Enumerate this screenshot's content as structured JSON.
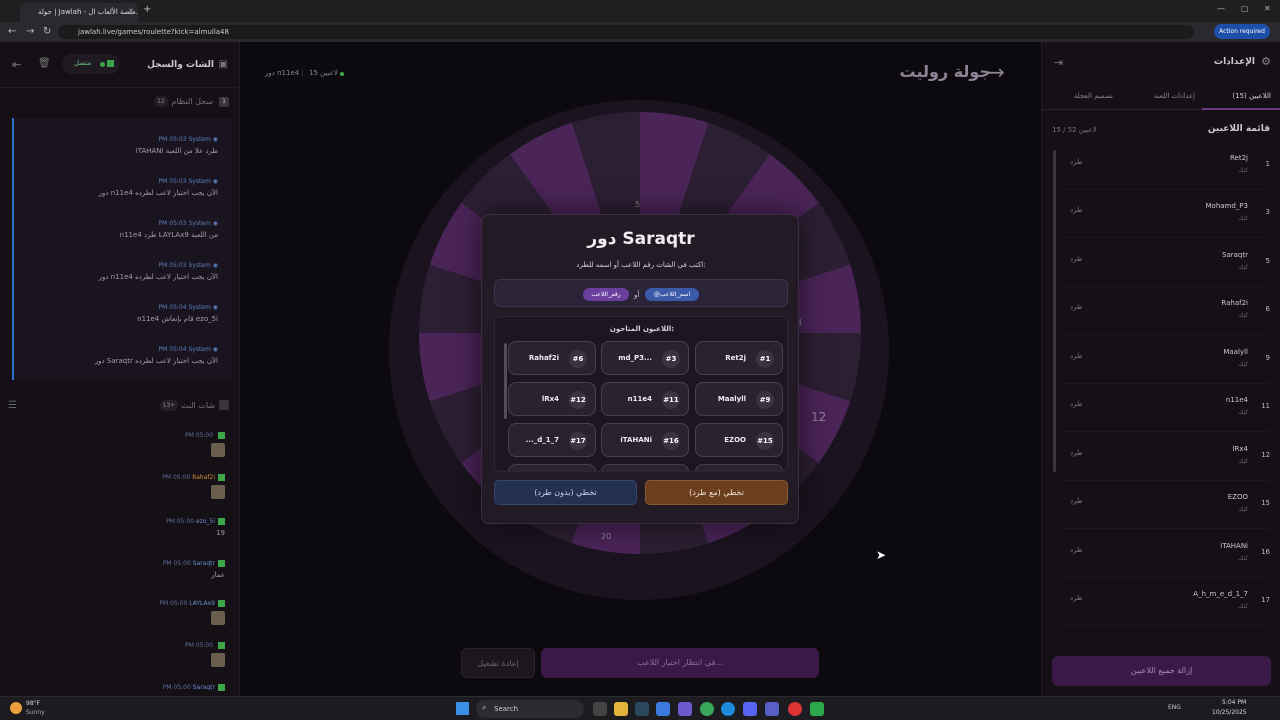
{
  "browser": {
    "tab_title": "جولة | Jawlah - منصة الألعاب ال...",
    "new_tab": "+",
    "url": "jawlah.live/games/roulette?kick=almulla48",
    "action_required": "Action required",
    "window_controls": [
      "—",
      "▢",
      "✕"
    ]
  },
  "left_panel": {
    "title": "الشات والسجل",
    "status": "متصل",
    "system_log": {
      "title": "سجل النظام",
      "count": "12",
      "badge": "1",
      "entries": [
        {
          "author": "System",
          "time": "PM 05:03",
          "text": "iTAHANi طرد علا من اللعبة"
        },
        {
          "author": "System",
          "time": "PM 05:03",
          "text": "دور n11e4 الآن يجب اختيار لاعب لطرده"
        },
        {
          "author": "System",
          "time": "PM 05:03",
          "text": "n11e4 طرد LAYLAx9 من اللعبة"
        },
        {
          "author": "System",
          "time": "PM 05:03",
          "text": "دور n11e4 الآن يجب اختيار لاعب لطرده"
        },
        {
          "author": "System",
          "time": "PM 05:04",
          "text": "n11e4 قام بإنعاش ezo_5i"
        },
        {
          "author": "System",
          "time": "PM 05:04",
          "text": "دور Saraqtr الآن يجب اختيار لاعب لطرده"
        }
      ]
    },
    "live_chat": {
      "title": "شات البث",
      "count": "13+",
      "entries": [
        {
          "author": "",
          "time": "PM 05:00",
          "text": "",
          "sticker": true
        },
        {
          "author": "Rahaf2i",
          "time": "PM 05:00",
          "text": "",
          "sticker": true
        },
        {
          "author": "ezo_5i",
          "time": "PM 05:00",
          "text": "19",
          "sticker": false
        },
        {
          "author": "Saraqtr",
          "time": "PM 05:00",
          "text": "عمار",
          "sticker": false
        },
        {
          "author": "LAYLAx9",
          "time": "PM 05:00",
          "text": "",
          "sticker": true
        },
        {
          "author": "",
          "time": "PM 05:00",
          "text": "",
          "sticker": true
        },
        {
          "author": "Saraqtr",
          "time": "PM 05:00",
          "text": "",
          "sticker": false
        }
      ]
    }
  },
  "center": {
    "title": "جولة روليت",
    "players_count": "15 لاعبين",
    "turn": "دور n11e4",
    "spin_button": "في انتظار اختيار اللاعب...",
    "replay_button": "إعادة تشغيل",
    "wheel_labels": [
      "5",
      "4",
      "12",
      "20"
    ]
  },
  "modal": {
    "title": "دور Saraqtr",
    "subtitle": "اكتب في الشات رقم اللاعب أو اسمه للطرد:",
    "hint_name": "@اسم_اللاعب",
    "hint_or": "أو",
    "hint_number": "رقم_اللاعب",
    "available_label": "اللاعبون المتاحون:",
    "players": [
      {
        "num": "#1",
        "name": "Ret2j"
      },
      {
        "num": "#3",
        "name": "md_P3..."
      },
      {
        "num": "#6",
        "name": "Rahaf2i"
      },
      {
        "num": "#9",
        "name": "Maalyll"
      },
      {
        "num": "#11",
        "name": "n11e4"
      },
      {
        "num": "#12",
        "name": "lRx4"
      },
      {
        "num": "#15",
        "name": "EZOO"
      },
      {
        "num": "#16",
        "name": "iTAHANi"
      },
      {
        "num": "#17",
        "name": "..._d_1_7"
      }
    ],
    "skip_with_kick": "تخطي (مع طرد)",
    "skip_no_kick": "تخطي (بدون طرد)"
  },
  "right_panel": {
    "title": "الإعدادات",
    "tabs": [
      "اللاعبين (15)",
      "إعدادات اللعبة",
      "تصميم العجلة"
    ],
    "list_title": "قائمة اللاعبين",
    "list_count": "15 / 52 لاعبين",
    "kick_label": "طرد",
    "players": [
      {
        "num": "1",
        "name": "Ret2j",
        "sub": "كيك"
      },
      {
        "num": "3",
        "name": "Mohamd_P3",
        "sub": "كيك"
      },
      {
        "num": "5",
        "name": "Saraqtr",
        "sub": "كيك"
      },
      {
        "num": "6",
        "name": "Rahaf2i",
        "sub": "كيك"
      },
      {
        "num": "9",
        "name": "Maalyll",
        "sub": "كيك"
      },
      {
        "num": "11",
        "name": "n11e4",
        "sub": "كيك"
      },
      {
        "num": "12",
        "name": "lRx4",
        "sub": "كيك"
      },
      {
        "num": "15",
        "name": "EZOO",
        "sub": "كيك"
      },
      {
        "num": "16",
        "name": "iTAHANi",
        "sub": "كيك"
      },
      {
        "num": "17",
        "name": "A_h_m_e_d_1_7",
        "sub": "كيك"
      }
    ],
    "clear_all": "إزالة جميع اللاعبين"
  },
  "taskbar": {
    "weather_temp": "98°F",
    "weather_text": "Sunny",
    "search": "Search",
    "lang": "ENG",
    "time": "5:04 PM",
    "date": "10/25/2025"
  },
  "colors": {
    "accent": "#4b2458",
    "kick_button": "#6b3f1e",
    "noskip_button": "#23304f"
  }
}
